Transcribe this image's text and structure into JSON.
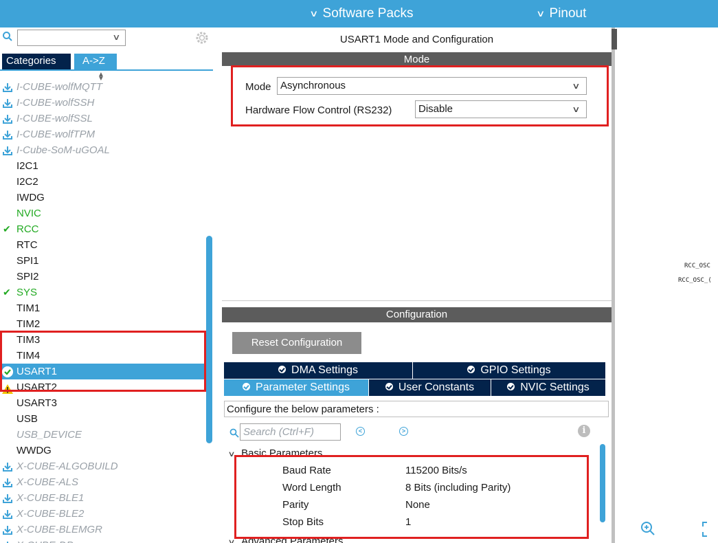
{
  "topbar": {
    "software_packs": "Software Packs",
    "pinout": "Pinout"
  },
  "left": {
    "tab_categories": "Categories",
    "tab_az": "A->Z",
    "items": [
      {
        "label": "I-CUBE-wolfMQTT",
        "style": "grey",
        "icon": "download-icon"
      },
      {
        "label": "I-CUBE-wolfSSH",
        "style": "grey",
        "icon": "download-icon"
      },
      {
        "label": "I-CUBE-wolfSSL",
        "style": "grey",
        "icon": "download-icon"
      },
      {
        "label": "I-CUBE-wolfTPM",
        "style": "grey",
        "icon": "download-icon"
      },
      {
        "label": "I-Cube-SoM-uGOAL",
        "style": "grey",
        "icon": "download-icon"
      },
      {
        "label": "I2C1",
        "style": "normal",
        "icon": ""
      },
      {
        "label": "I2C2",
        "style": "normal",
        "icon": ""
      },
      {
        "label": "IWDG",
        "style": "normal",
        "icon": ""
      },
      {
        "label": "NVIC",
        "style": "green",
        "icon": ""
      },
      {
        "label": "RCC",
        "style": "green",
        "icon": "check-icon"
      },
      {
        "label": "RTC",
        "style": "normal",
        "icon": ""
      },
      {
        "label": "SPI1",
        "style": "normal",
        "icon": ""
      },
      {
        "label": "SPI2",
        "style": "normal",
        "icon": ""
      },
      {
        "label": "SYS",
        "style": "green",
        "icon": "check-icon"
      },
      {
        "label": "TIM1",
        "style": "normal",
        "icon": ""
      },
      {
        "label": "TIM2",
        "style": "normal",
        "icon": ""
      },
      {
        "label": "TIM3",
        "style": "normal",
        "icon": ""
      },
      {
        "label": "TIM4",
        "style": "normal",
        "icon": ""
      },
      {
        "label": "USART1",
        "style": "selected",
        "icon": "check-circle-icon"
      },
      {
        "label": "USART2",
        "style": "normal",
        "icon": "warning-icon"
      },
      {
        "label": "USART3",
        "style": "normal",
        "icon": ""
      },
      {
        "label": "USB",
        "style": "normal",
        "icon": ""
      },
      {
        "label": "USB_DEVICE",
        "style": "grey",
        "icon": ""
      },
      {
        "label": "WWDG",
        "style": "normal",
        "icon": ""
      },
      {
        "label": "X-CUBE-ALGOBUILD",
        "style": "grey",
        "icon": "download-icon"
      },
      {
        "label": "X-CUBE-ALS",
        "style": "grey",
        "icon": "download-icon"
      },
      {
        "label": "X-CUBE-BLE1",
        "style": "grey",
        "icon": "download-icon"
      },
      {
        "label": "X-CUBE-BLE2",
        "style": "grey",
        "icon": "download-icon"
      },
      {
        "label": "X-CUBE-BLEMGR",
        "style": "grey",
        "icon": "download-icon"
      },
      {
        "label": "X-CUBE-DPower",
        "style": "grey",
        "icon": "download-icon"
      }
    ]
  },
  "mid": {
    "title": "USART1 Mode and Configuration",
    "mode_header": "Mode",
    "mode_label": "Mode",
    "mode_value": "Asynchronous",
    "flow_label": "Hardware Flow Control (RS232)",
    "flow_value": "Disable",
    "config_header": "Configuration",
    "reset_button": "Reset Configuration",
    "tabs": {
      "dma": "DMA Settings",
      "gpio": "GPIO Settings",
      "param": "Parameter Settings",
      "user": "User Constants",
      "nvic": "NVIC Settings"
    },
    "configure_text": "Configure the below parameters :",
    "search_placeholder": "Search (Ctrl+F)",
    "group_basic": "Basic Parameters",
    "group_advanced": "Advanced Parameters",
    "params": [
      {
        "name": "Baud Rate",
        "value": "115200 Bits/s"
      },
      {
        "name": "Word Length",
        "value": "8 Bits (including Parity)"
      },
      {
        "name": "Parity",
        "value": "None"
      },
      {
        "name": "Stop Bits",
        "value": "1"
      }
    ]
  },
  "right": {
    "pin1": "RCC_OSC",
    "pin2": "RCC_OSC_("
  },
  "colors": {
    "accent": "#3ea3d8",
    "dark_navy": "#03234b",
    "highlight_red": "#e02020",
    "ok_green": "#22aa22"
  }
}
